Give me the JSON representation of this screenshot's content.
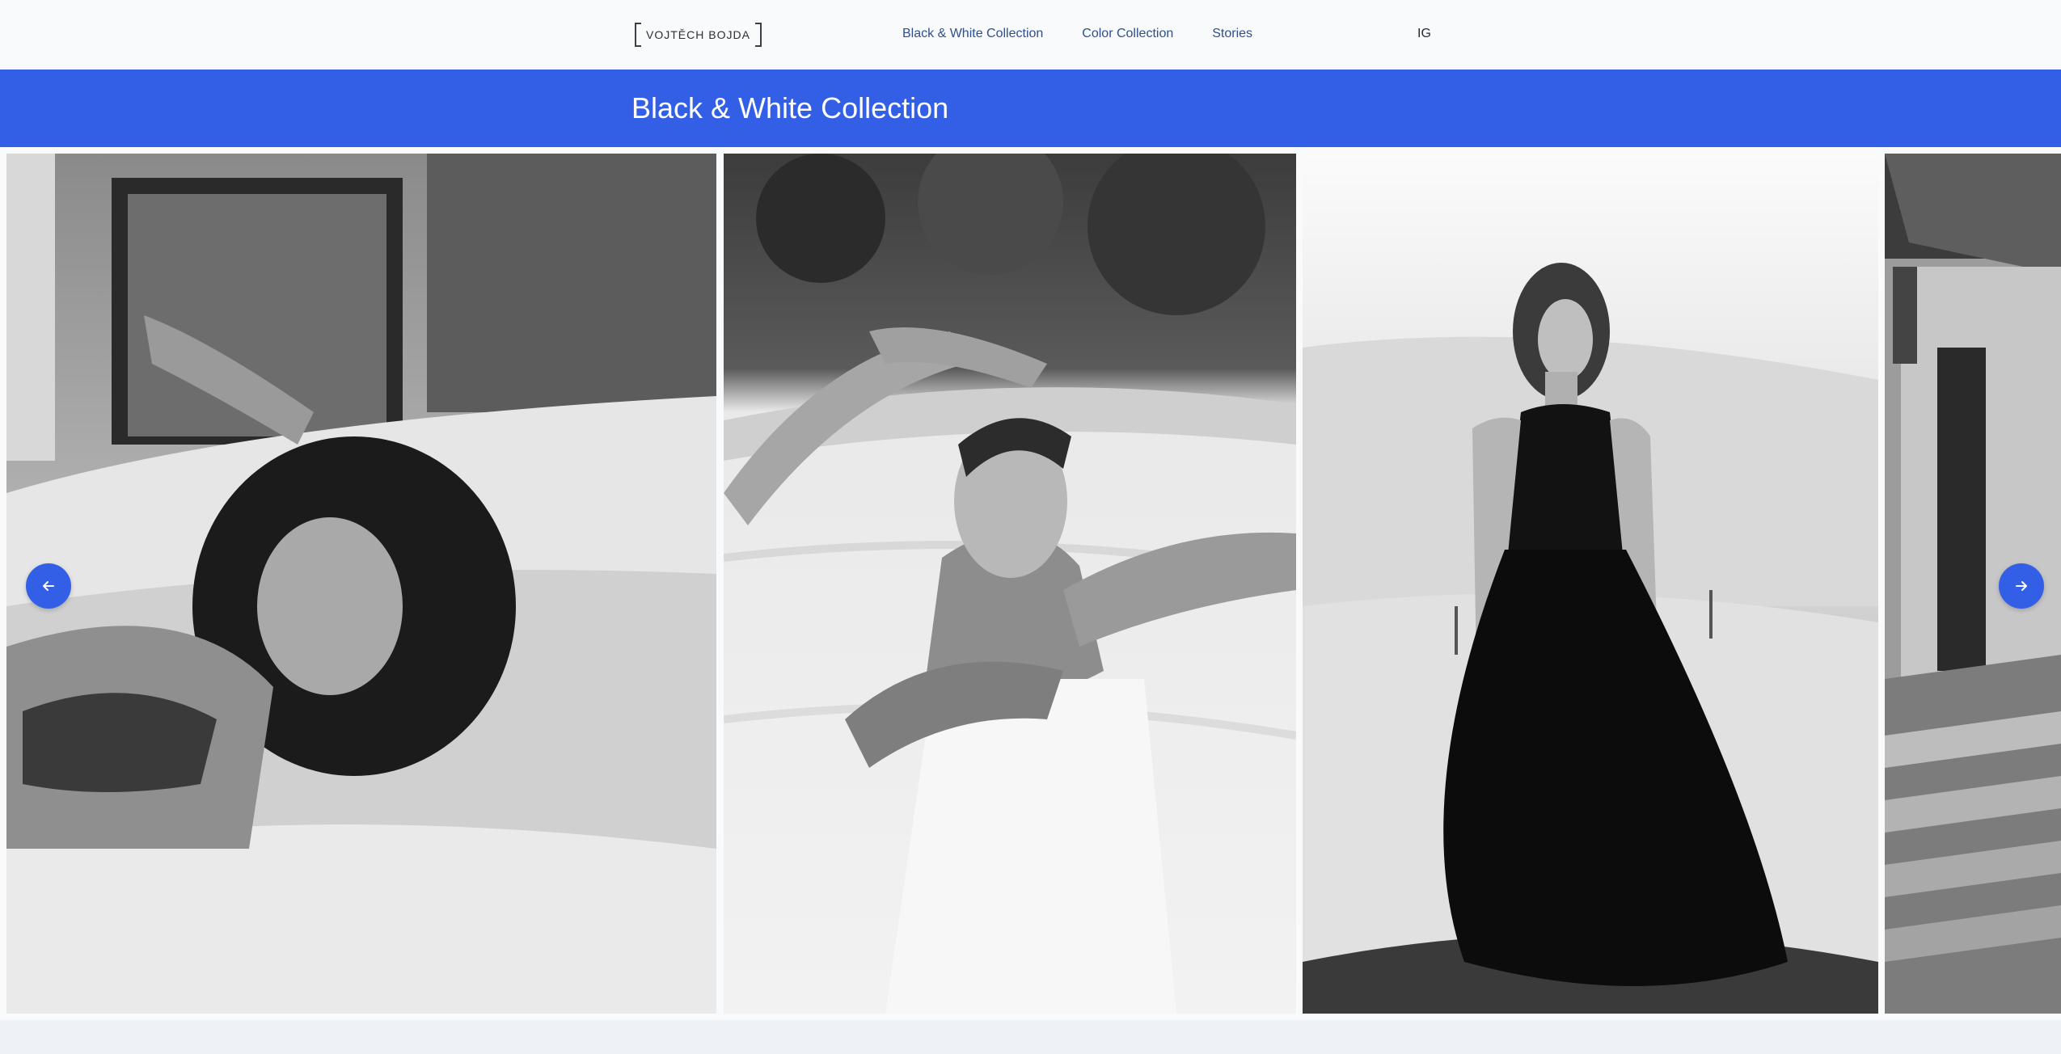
{
  "header": {
    "logo_text": "VOJTĚCH BOJDA",
    "nav": [
      {
        "label": "Black & White Collection"
      },
      {
        "label": "Color Collection"
      },
      {
        "label": "Stories"
      }
    ],
    "instagram": "IG"
  },
  "banner": {
    "title": "Black & White Collection"
  },
  "gallery": {
    "photos": [
      {
        "subject": "woman-lying-on-bed"
      },
      {
        "subject": "woman-in-pool"
      },
      {
        "subject": "woman-in-black-dress-on-dunes"
      },
      {
        "subject": "stone-stairway-alley"
      }
    ],
    "prev_icon": "arrow-left-icon",
    "next_icon": "arrow-right-icon"
  },
  "colors": {
    "accent": "#335fe6",
    "header_bg": "#f8fafc",
    "nav_text": "#2e4f8f"
  }
}
